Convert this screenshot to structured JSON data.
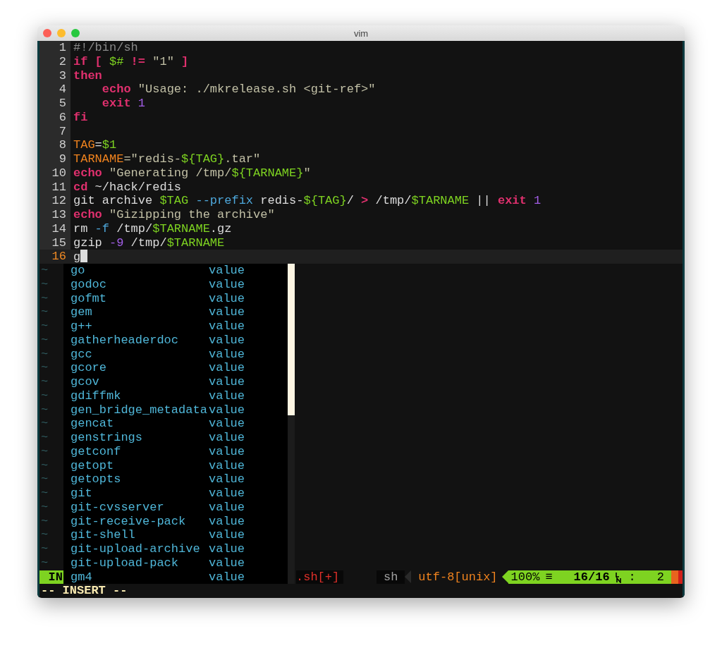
{
  "window": {
    "title": "vim"
  },
  "lines": [
    {
      "number": "1",
      "current": false,
      "tokens": [
        {
          "text": "#!/bin/sh",
          "kind": "comment"
        }
      ]
    },
    {
      "number": "2",
      "current": false,
      "tokens": [
        {
          "text": "if [ ",
          "kind": "keyword"
        },
        {
          "text": "$#",
          "kind": "variable"
        },
        {
          "text": " != ",
          "kind": "keyword"
        },
        {
          "text": "\"1\"",
          "kind": "string"
        },
        {
          "text": " ]",
          "kind": "keyword"
        }
      ]
    },
    {
      "number": "3",
      "current": false,
      "tokens": [
        {
          "text": "then",
          "kind": "keyword"
        }
      ]
    },
    {
      "number": "4",
      "current": false,
      "tokens": [
        {
          "text": "    echo",
          "kind": "keyword"
        },
        {
          "text": " \"Usage: ./mkrelease.sh <git-ref>\"",
          "kind": "string"
        }
      ]
    },
    {
      "number": "5",
      "current": false,
      "tokens": [
        {
          "text": "    exit",
          "kind": "keyword"
        },
        {
          "text": " 1",
          "kind": "number"
        }
      ]
    },
    {
      "number": "6",
      "current": false,
      "tokens": [
        {
          "text": "fi",
          "kind": "keyword"
        }
      ]
    },
    {
      "number": "7",
      "current": false
    },
    {
      "number": "8",
      "current": false,
      "tokens": [
        {
          "text": "TAG",
          "kind": "assign"
        },
        {
          "text": "=",
          "kind": "plain"
        },
        {
          "text": "$1",
          "kind": "variable"
        }
      ]
    },
    {
      "number": "9",
      "current": false,
      "tokens": [
        {
          "text": "TARNAME",
          "kind": "assign"
        },
        {
          "text": "=\"redis-",
          "kind": "string"
        },
        {
          "text": "${TAG}",
          "kind": "variable"
        },
        {
          "text": ".tar\"",
          "kind": "string"
        }
      ]
    },
    {
      "number": "10",
      "current": false,
      "tokens": [
        {
          "text": "echo",
          "kind": "keyword"
        },
        {
          "text": " \"Generating /tmp/",
          "kind": "string"
        },
        {
          "text": "${TARNAME}",
          "kind": "variable"
        },
        {
          "text": "\"",
          "kind": "string"
        }
      ]
    },
    {
      "number": "11",
      "current": false,
      "tokens": [
        {
          "text": "cd",
          "kind": "keyword"
        },
        {
          "text": " ~/hack/redis",
          "kind": "plain"
        }
      ]
    },
    {
      "number": "12",
      "current": false,
      "tokens": [
        {
          "text": "git archive ",
          "kind": "plain"
        },
        {
          "text": "$TAG",
          "kind": "variable"
        },
        {
          "text": " --prefix",
          "kind": "option"
        },
        {
          "text": " redis-",
          "kind": "plain"
        },
        {
          "text": "${TAG}",
          "kind": "variable"
        },
        {
          "text": "/ ",
          "kind": "plain"
        },
        {
          "text": ">",
          "kind": "keyword"
        },
        {
          "text": " /tmp/",
          "kind": "plain"
        },
        {
          "text": "$TARNAME",
          "kind": "variable"
        },
        {
          "text": " || ",
          "kind": "plain"
        },
        {
          "text": "exit",
          "kind": "keyword"
        },
        {
          "text": " 1",
          "kind": "number"
        }
      ]
    },
    {
      "number": "13",
      "current": false,
      "tokens": [
        {
          "text": "echo",
          "kind": "keyword"
        },
        {
          "text": " \"Gizipping the archive\"",
          "kind": "string"
        }
      ]
    },
    {
      "number": "14",
      "current": false,
      "tokens": [
        {
          "text": "rm ",
          "kind": "plain"
        },
        {
          "text": "-f",
          "kind": "option"
        },
        {
          "text": " /tmp/",
          "kind": "plain"
        },
        {
          "text": "$TARNAME",
          "kind": "variable"
        },
        {
          "text": ".gz",
          "kind": "plain"
        }
      ]
    },
    {
      "number": "15",
      "current": false,
      "tokens": [
        {
          "text": "gzip ",
          "kind": "plain"
        },
        {
          "text": "-9",
          "kind": "number"
        },
        {
          "text": " /tmp/",
          "kind": "plain"
        },
        {
          "text": "$TARNAME",
          "kind": "variable"
        }
      ]
    },
    {
      "number": "16",
      "current": true,
      "tokens": [
        {
          "text": "g",
          "kind": "plain"
        }
      ]
    }
  ],
  "empty_lines": [
    "~",
    "~",
    "~",
    "~",
    "~",
    "~",
    "~",
    "~",
    "~",
    "~",
    "~",
    "~",
    "~",
    "~",
    "~",
    "~",
    "~",
    "~",
    "~",
    "~",
    "~",
    "~"
  ],
  "completion_menu": {
    "items": [
      {
        "word": "go",
        "info": "value",
        "selected": false
      },
      {
        "word": "godoc",
        "info": "value",
        "selected": false
      },
      {
        "word": "gofmt",
        "info": "value",
        "selected": false
      },
      {
        "word": "gem",
        "info": "value",
        "selected": false
      },
      {
        "word": "g++",
        "info": "value",
        "selected": false
      },
      {
        "word": "gatherheaderdoc",
        "info": "value",
        "selected": false
      },
      {
        "word": "gcc",
        "info": "value",
        "selected": false
      },
      {
        "word": "gcore",
        "info": "value",
        "selected": false
      },
      {
        "word": "gcov",
        "info": "value",
        "selected": false
      },
      {
        "word": "gdiffmk",
        "info": "value",
        "selected": false
      },
      {
        "word": "gen_bridge_metadata",
        "info": "value",
        "selected": false
      },
      {
        "word": "gencat",
        "info": "value",
        "selected": false
      },
      {
        "word": "genstrings",
        "info": "value",
        "selected": false
      },
      {
        "word": "getconf",
        "info": "value",
        "selected": false
      },
      {
        "word": "getopt",
        "info": "value",
        "selected": false
      },
      {
        "word": "getopts",
        "info": "value",
        "selected": false
      },
      {
        "word": "git",
        "info": "value",
        "selected": false
      },
      {
        "word": "git-cvsserver",
        "info": "value",
        "selected": false
      },
      {
        "word": "git-receive-pack",
        "info": "value",
        "selected": false
      },
      {
        "word": "git-shell",
        "info": "value",
        "selected": false
      },
      {
        "word": "git-upload-archive",
        "info": "value",
        "selected": false
      },
      {
        "word": "git-upload-pack",
        "info": "value",
        "selected": false
      },
      {
        "word": "gm4",
        "info": "value",
        "selected": false
      }
    ]
  },
  "status_line": {
    "mode": "IN",
    "file": ".sh[+]",
    "filetype": "sh",
    "encoding": "utf-8[unix]",
    "percent": "100%",
    "percent_symbol": "≡",
    "position": "16/16",
    "separator": ":",
    "column": "2"
  },
  "command_line": "-- INSERT --"
}
